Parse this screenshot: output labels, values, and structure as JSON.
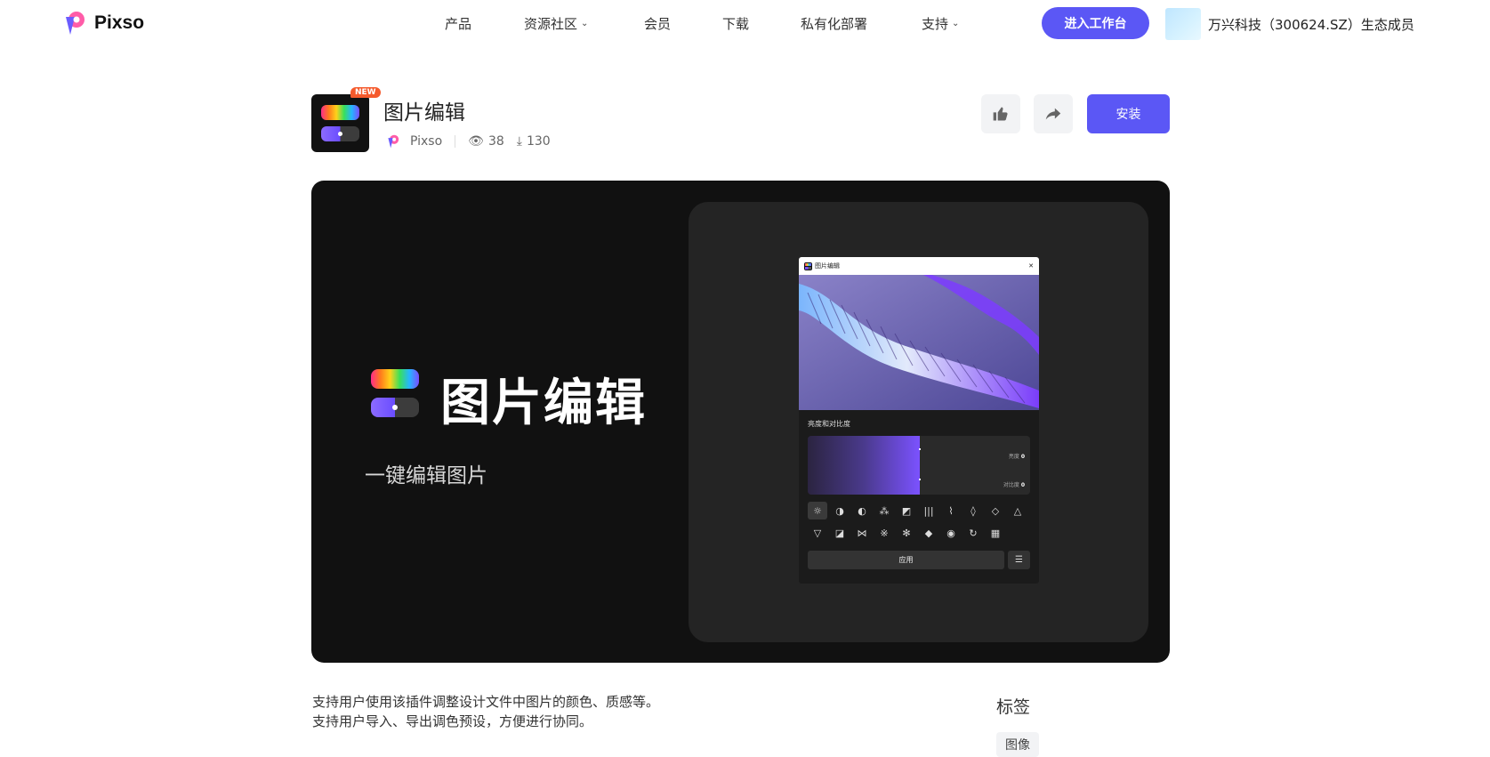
{
  "nav": {
    "brand": "Pixso",
    "items": [
      {
        "label": "产品",
        "dropdown": false
      },
      {
        "label": "资源社区",
        "dropdown": true
      },
      {
        "label": "会员",
        "dropdown": false
      },
      {
        "label": "下载",
        "dropdown": false
      },
      {
        "label": "私有化部署",
        "dropdown": false
      },
      {
        "label": "支持",
        "dropdown": true
      }
    ],
    "enter_button": "进入工作台",
    "member_text": "万兴科技（300624.SZ）生态成员"
  },
  "plugin": {
    "badge": "NEW",
    "title": "图片编辑",
    "author": "Pixso",
    "views": "38",
    "downloads": "130",
    "like_icon": "thumbs-up-icon",
    "share_icon": "share-icon",
    "install_button": "安装"
  },
  "banner": {
    "title": "图片编辑",
    "subtitle": "一键编辑图片",
    "mini_panel": {
      "title": "图片编辑",
      "section_label": "亮度和对比度",
      "brightness_label": "亮度",
      "brightness_value": "0",
      "contrast_label": "对比度",
      "contrast_value": "0",
      "apply_button": "应用"
    }
  },
  "description": {
    "line1": "支持用户使用该插件调整设计文件中图片的颜色、质感等。",
    "line2": "支持用户导入、导出调色预设，方便进行协同。"
  },
  "tags": {
    "title": "标签",
    "items": [
      "图像"
    ]
  },
  "colors": {
    "accent": "#5b57f5",
    "new_badge": "#f55a2c",
    "banner_bg": "#111111"
  }
}
